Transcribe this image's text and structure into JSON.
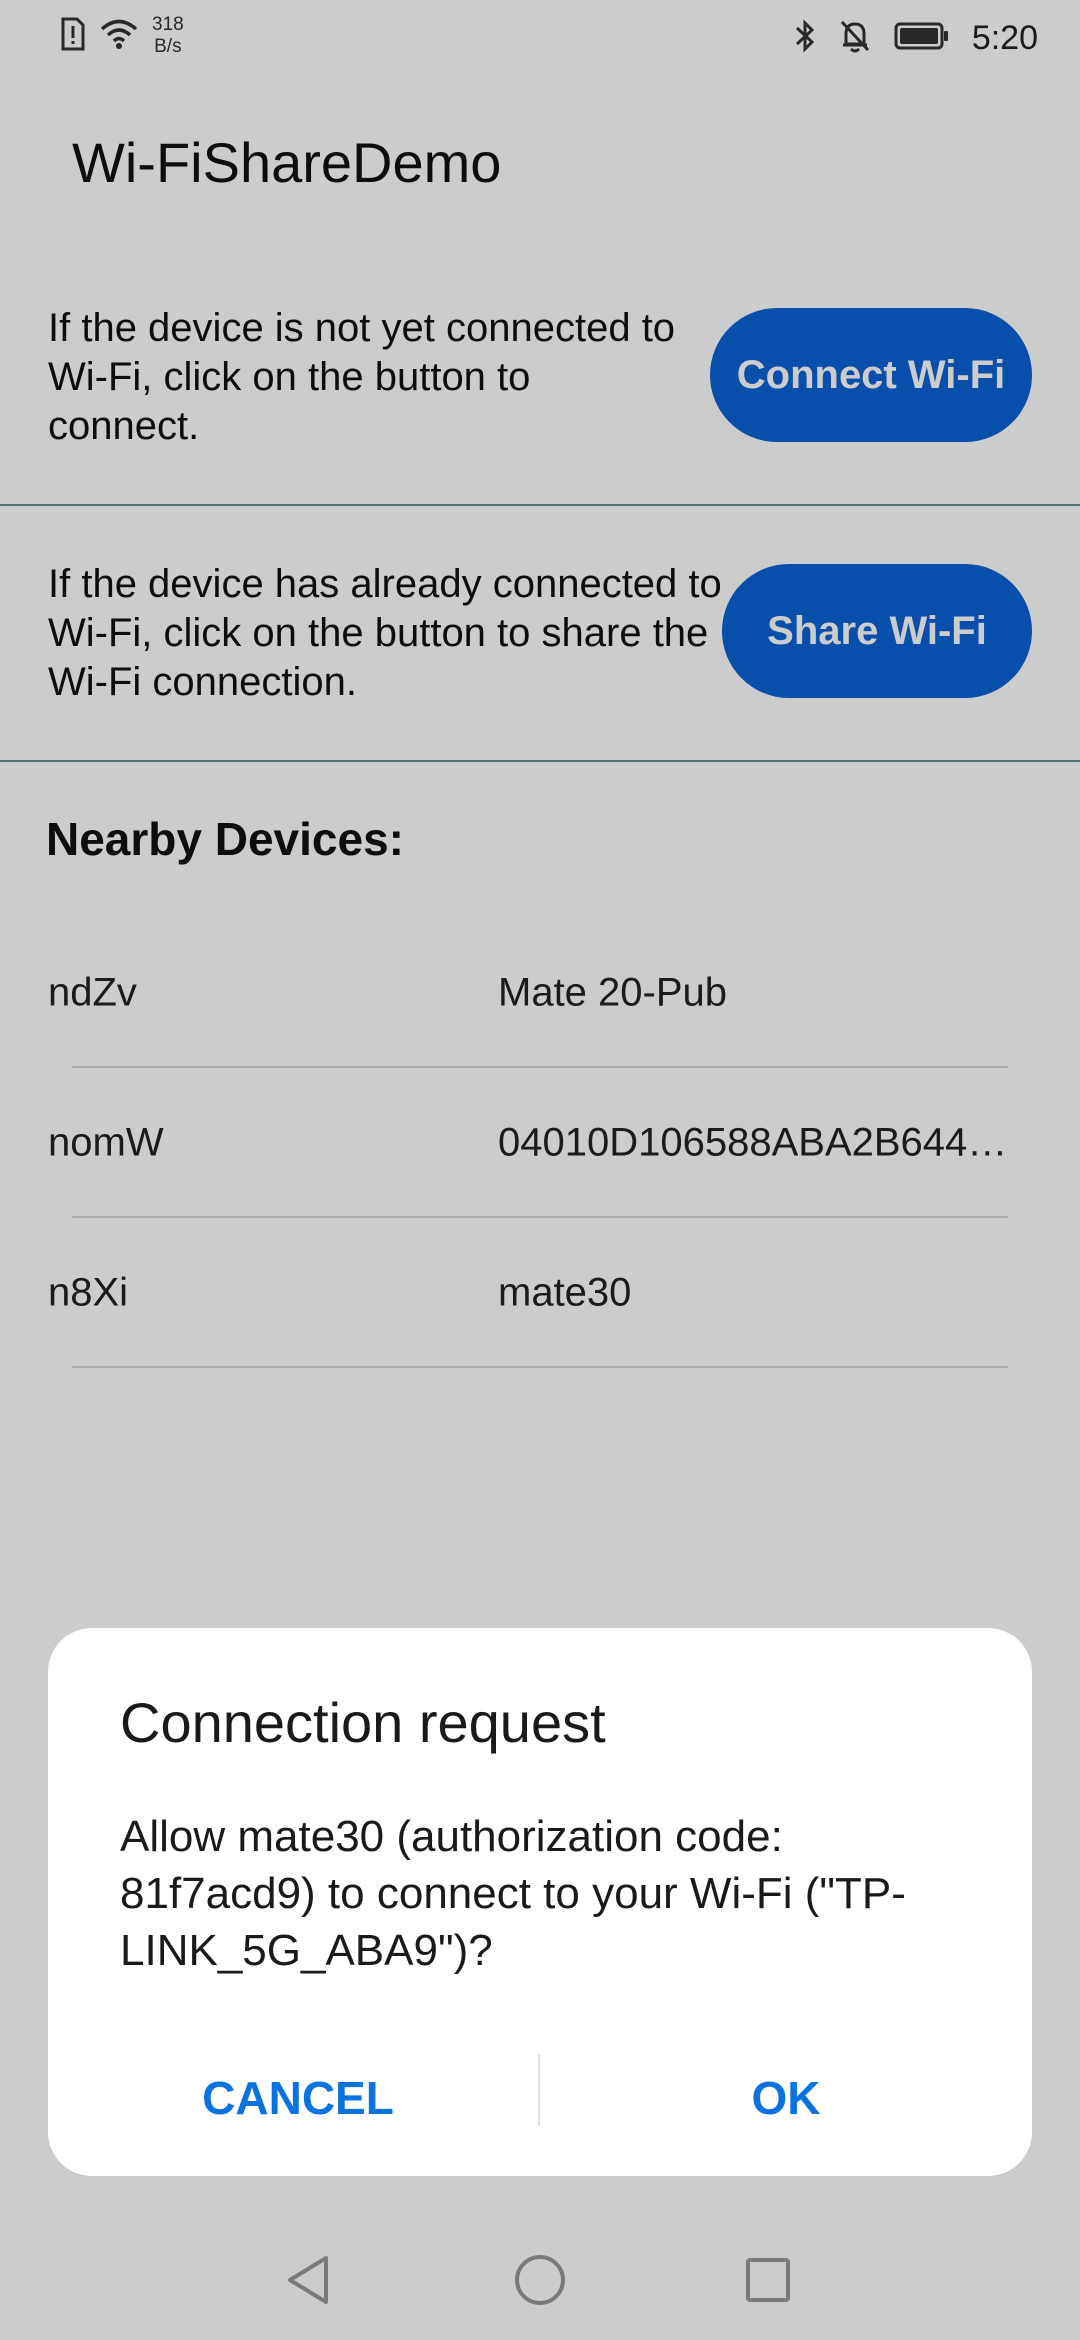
{
  "status_bar": {
    "net_speed_value": "318",
    "net_speed_unit": "B/s",
    "time": "5:20",
    "left_icons": [
      "sim-alert-icon",
      "wifi-icon"
    ],
    "right_icons": [
      "bluetooth-icon",
      "bell-off-icon",
      "battery-icon"
    ]
  },
  "app": {
    "title": "Wi-FiShareDemo"
  },
  "connect_section": {
    "text": "If the device is not yet connected to Wi-Fi, click on the button to connect.",
    "button_label": "Connect Wi-Fi"
  },
  "share_section": {
    "text": "If the device has already connected to Wi-Fi, click on the button to share the Wi-Fi connection.",
    "button_label": "Share Wi-Fi"
  },
  "nearby": {
    "title": "Nearby Devices:",
    "devices": [
      {
        "id": "ndZv",
        "name": "Mate 20-Pub"
      },
      {
        "id": "nomW",
        "name": "04010D106588ABA2B644…"
      },
      {
        "id": "n8Xi",
        "name": "mate30"
      }
    ]
  },
  "dialog": {
    "title": "Connection request",
    "message": "Allow mate30 (authorization code: 81f7acd9) to connect to your Wi-Fi (\"TP-LINK_5G_ABA9\")?",
    "cancel_label": "CANCEL",
    "ok_label": "OK"
  },
  "colors": {
    "accent": "#0a62d6",
    "dialog_button": "#0a73e0"
  },
  "nav_bar": {
    "icons": [
      "back-icon",
      "home-icon",
      "recents-icon"
    ]
  }
}
